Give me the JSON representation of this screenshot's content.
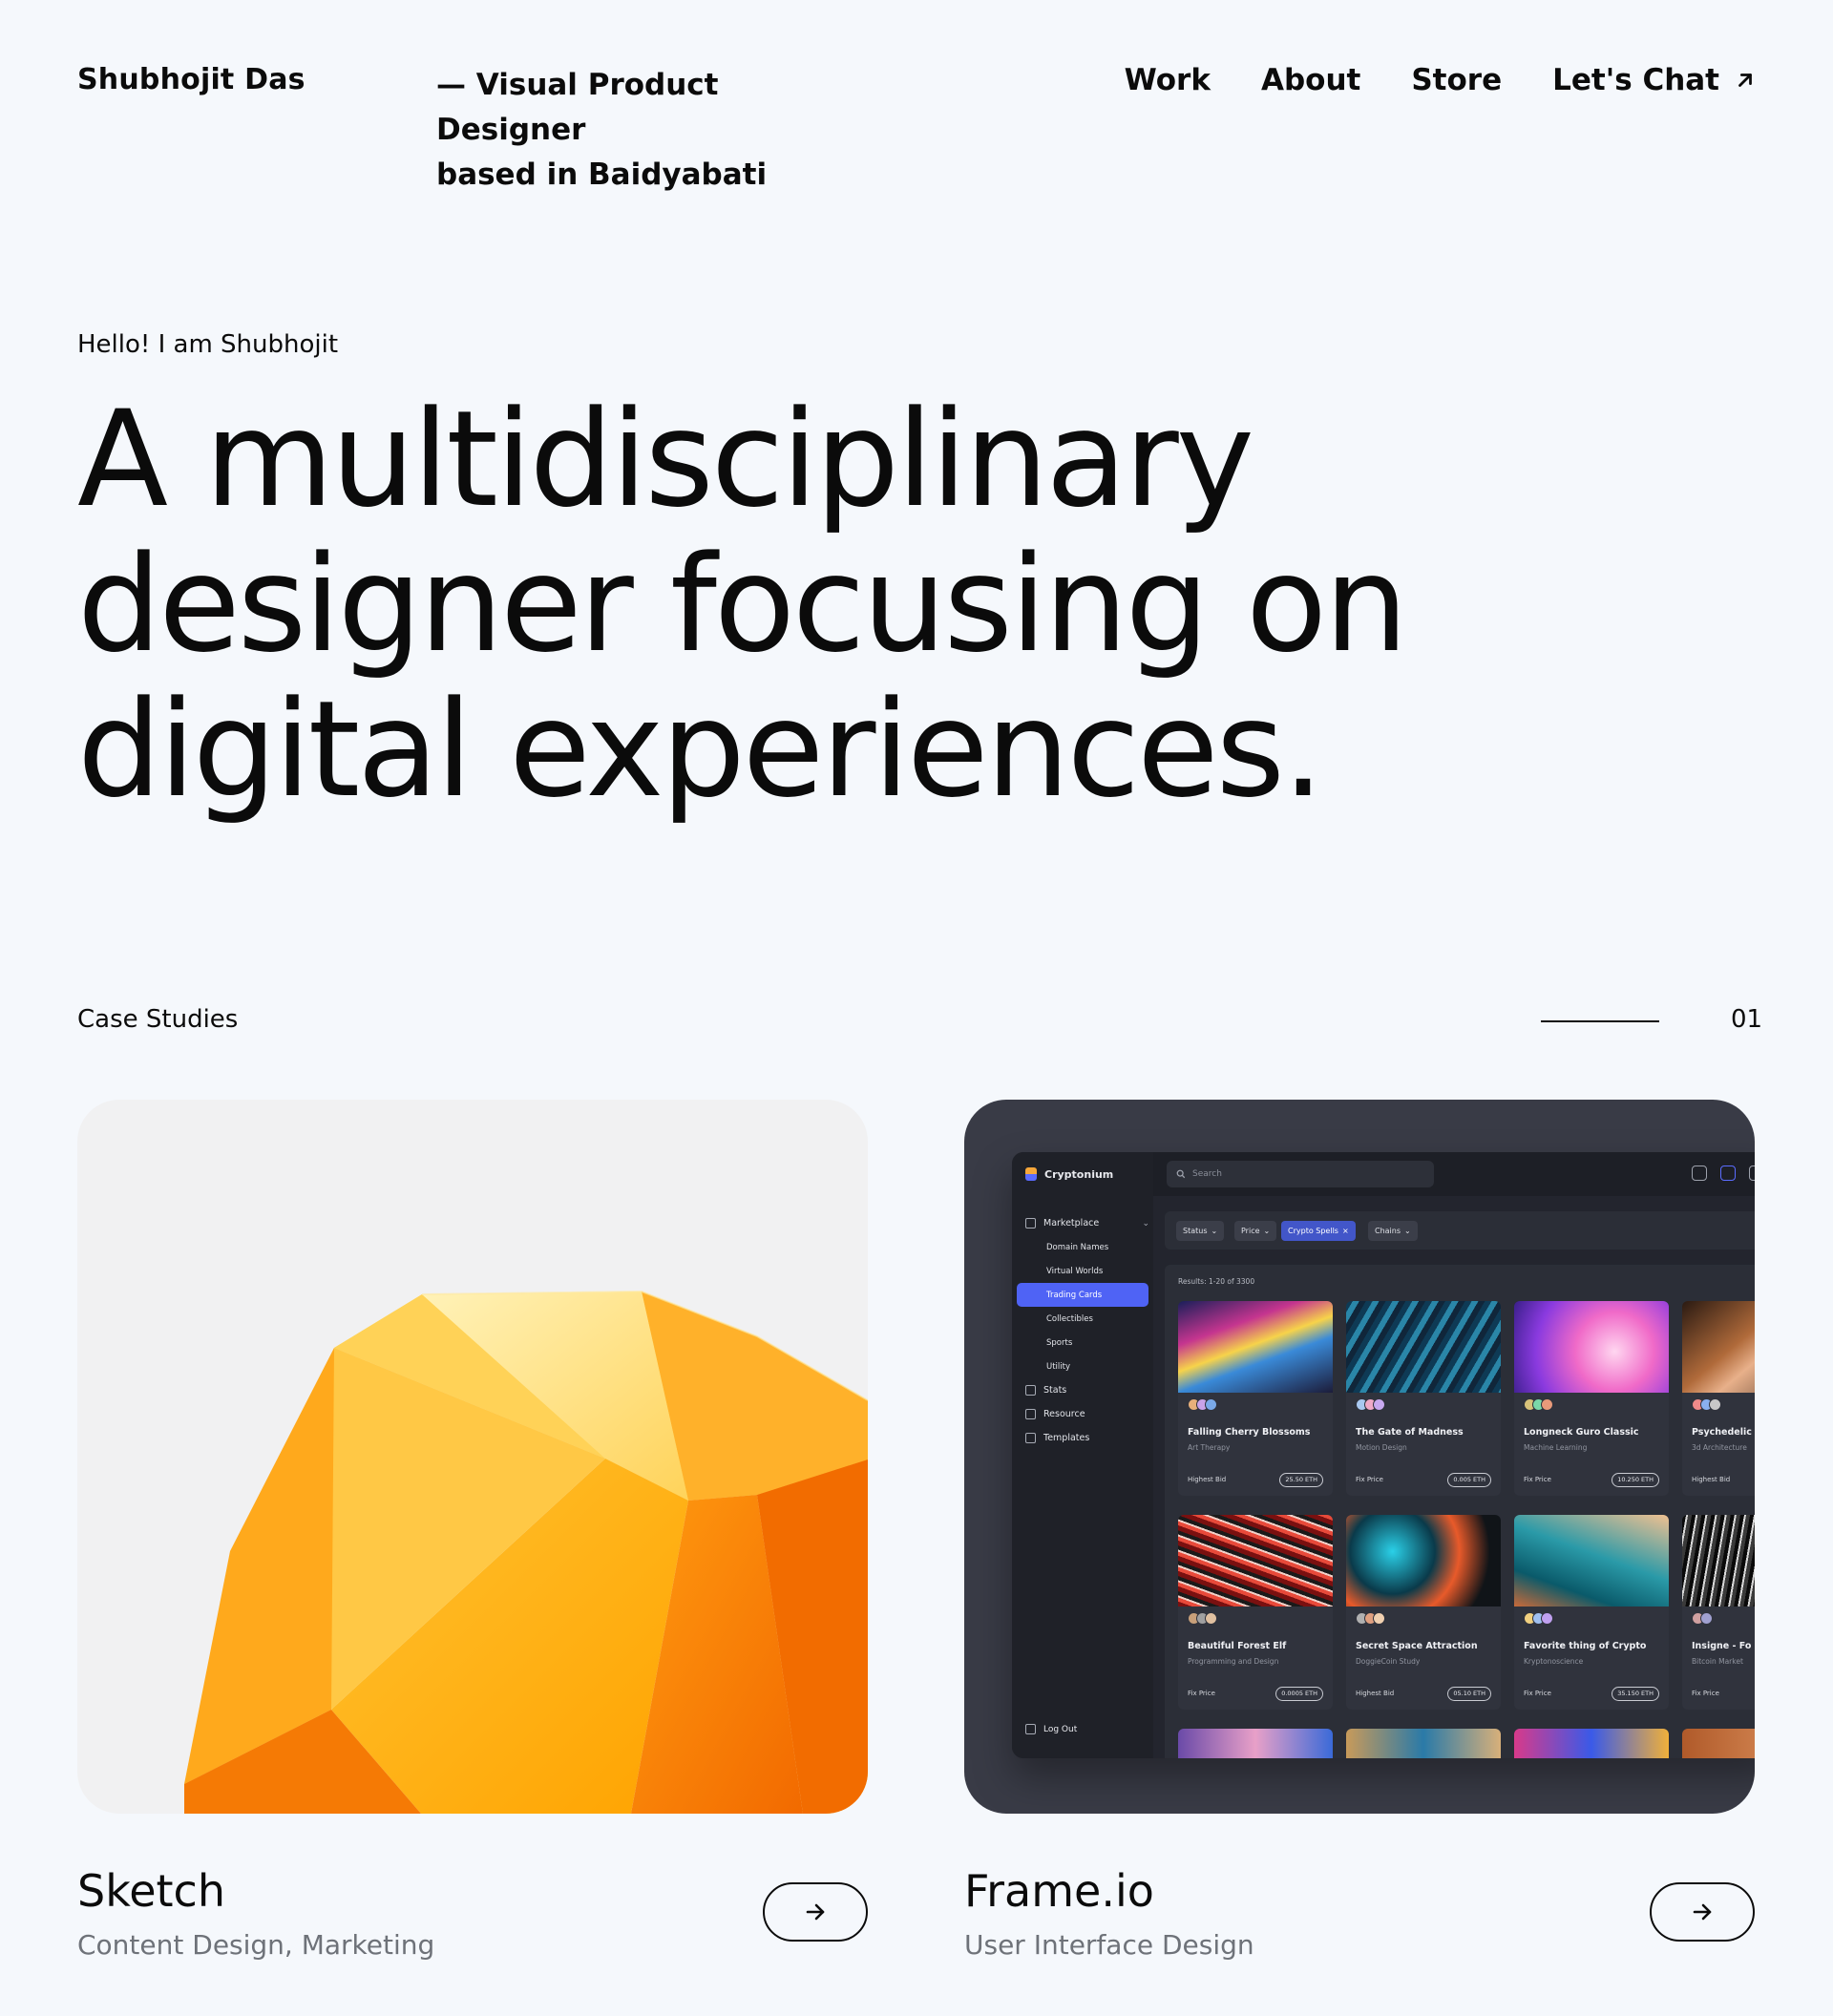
{
  "header": {
    "brand": "Shubhojit Das",
    "tagline_line1": "— Visual Product Designer",
    "tagline_line2": "based in Baidyabati",
    "nav": [
      {
        "label": "Work"
      },
      {
        "label": "About"
      },
      {
        "label": "Store"
      },
      {
        "label": "Let's Chat",
        "icon": "arrow-up-right-icon"
      }
    ]
  },
  "hero": {
    "greeting": "Hello! I am Shubhojit",
    "line1": "A multidisciplinary",
    "line2": "designer focusing on",
    "line3": "digital experiences."
  },
  "section": {
    "label": "Case Studies",
    "index": "01"
  },
  "cards": [
    {
      "title": "Sketch",
      "subtitle": "Content Design, Marketing",
      "button_icon": "arrow-right-icon"
    },
    {
      "title": "Frame.io",
      "subtitle": "User Interface Design",
      "button_icon": "arrow-right-icon"
    }
  ],
  "dashboard": {
    "app_name": "Cryptonium",
    "search_placeholder": "Search",
    "menu": [
      {
        "label": "Marketplace",
        "icon": "grid-icon"
      },
      {
        "label": "Domain Names"
      },
      {
        "label": "Virtual Worlds"
      },
      {
        "label": "Trading Cards",
        "selected": true
      },
      {
        "label": "Collectibles"
      },
      {
        "label": "Sports"
      },
      {
        "label": "Utility"
      },
      {
        "label": "Stats",
        "icon": "chart-icon"
      },
      {
        "label": "Resource",
        "icon": "inbox-icon"
      },
      {
        "label": "Templates",
        "icon": "folder-icon"
      }
    ],
    "logout": "Log Out",
    "filters": [
      "Status",
      "Price",
      "Crypto Spells",
      "Chains"
    ],
    "active_filter": "Crypto Spells",
    "results": "Results: 1-20 of 3300",
    "items": [
      {
        "name": "Falling Cherry Blossoms",
        "category": "Art Therapy",
        "label": "Highest Bid",
        "price": "25.50 ETH"
      },
      {
        "name": "The Gate of Madness",
        "category": "Motion Design",
        "label": "Fix Price",
        "price": "0.005 ETH"
      },
      {
        "name": "Longneck Guro Classic",
        "category": "Machine Learning",
        "label": "Fix Price",
        "price": "10.250 ETH"
      },
      {
        "name": "Psychedelic",
        "category": "3d Architecture",
        "label": "Highest Bid",
        "price": ""
      },
      {
        "name": "Beautiful Forest Elf",
        "category": "Programming and Design",
        "label": "Fix Price",
        "price": "0.0005 ETH"
      },
      {
        "name": "Secret Space Attraction",
        "category": "DoggieCoin Study",
        "label": "Highest Bid",
        "price": "05.10 ETH"
      },
      {
        "name": "Favorite thing of Crypto",
        "category": "Kryptonoscience",
        "label": "Fix Price",
        "price": "35.150 ETH"
      },
      {
        "name": "Insigne - Fo",
        "category": "Bitcoin Market",
        "label": "Fix Price",
        "price": ""
      }
    ]
  }
}
